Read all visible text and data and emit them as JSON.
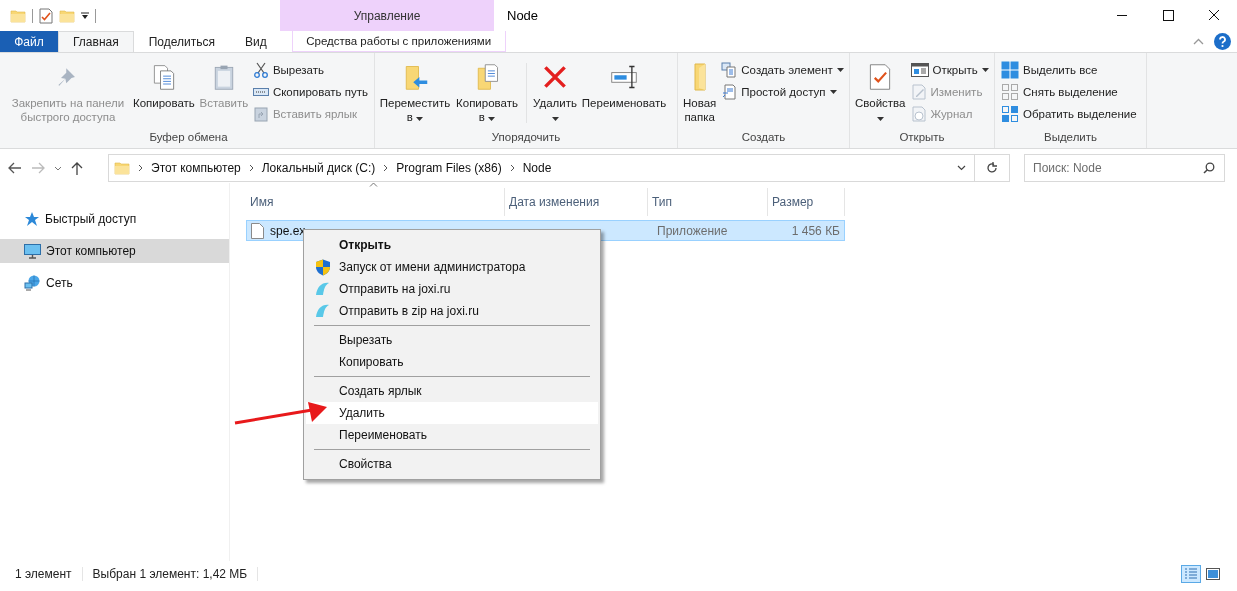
{
  "window": {
    "title": "Node",
    "context_header": "Управление"
  },
  "tabs": [
    {
      "label": "Файл",
      "kind": "file",
      "selected": false
    },
    {
      "label": "Главная",
      "kind": "normal",
      "selected": true
    },
    {
      "label": "Поделиться",
      "kind": "normal",
      "selected": false
    },
    {
      "label": "Вид",
      "kind": "normal",
      "selected": false
    },
    {
      "label": "Средства работы с приложениями",
      "kind": "contextual",
      "selected": false
    }
  ],
  "ribbon": {
    "groups": [
      {
        "label": "Буфер обмена",
        "items": [
          {
            "label": "Закрепить на панели быстрого доступа",
            "kind": "large",
            "disabled": true,
            "dropdown": false
          },
          {
            "label": "Копировать",
            "kind": "large",
            "disabled": false,
            "dropdown": false
          },
          {
            "label": "Вставить",
            "kind": "large",
            "disabled": true,
            "dropdown": false
          },
          {
            "label": "Вырезать",
            "kind": "small",
            "disabled": false,
            "dropdown": false
          },
          {
            "label": "Скопировать путь",
            "kind": "small",
            "disabled": false,
            "dropdown": false
          },
          {
            "label": "Вставить ярлык",
            "kind": "small",
            "disabled": true,
            "dropdown": false
          }
        ]
      },
      {
        "label": "Упорядочить",
        "items": [
          {
            "label": "Переместить в",
            "kind": "large",
            "disabled": false,
            "dropdown": true
          },
          {
            "label": "Копировать в",
            "kind": "large",
            "disabled": false,
            "dropdown": true
          },
          {
            "label": "Удалить",
            "kind": "large",
            "disabled": false,
            "dropdown": true
          },
          {
            "label": "Переименовать",
            "kind": "large",
            "disabled": false,
            "dropdown": false
          }
        ]
      },
      {
        "label": "Создать",
        "items": [
          {
            "label": "Новая папка",
            "kind": "large",
            "disabled": false,
            "dropdown": false
          },
          {
            "label": "Создать элемент",
            "kind": "small",
            "disabled": false,
            "dropdown": true
          },
          {
            "label": "Простой доступ",
            "kind": "small",
            "disabled": false,
            "dropdown": true
          }
        ]
      },
      {
        "label": "Открыть",
        "items": [
          {
            "label": "Свойства",
            "kind": "large",
            "disabled": false,
            "dropdown": true
          },
          {
            "label": "Открыть",
            "kind": "small",
            "disabled": false,
            "dropdown": true
          },
          {
            "label": "Изменить",
            "kind": "small",
            "disabled": true,
            "dropdown": false
          },
          {
            "label": "Журнал",
            "kind": "small",
            "disabled": true,
            "dropdown": false
          }
        ]
      },
      {
        "label": "Выделить",
        "items": [
          {
            "label": "Выделить все",
            "kind": "small",
            "disabled": false,
            "dropdown": false
          },
          {
            "label": "Снять выделение",
            "kind": "small",
            "disabled": false,
            "dropdown": false
          },
          {
            "label": "Обратить выделение",
            "kind": "small",
            "disabled": false,
            "dropdown": false
          }
        ]
      }
    ]
  },
  "address": {
    "breadcrumb": [
      "Этот компьютер",
      "Локальный диск (C:)",
      "Program Files (x86)",
      "Node"
    ],
    "search": {
      "placeholder": "Поиск: Node"
    }
  },
  "sidebar": {
    "items": [
      {
        "label": "Быстрый доступ",
        "selected": false
      },
      {
        "label": "Этот компьютер",
        "selected": true
      },
      {
        "label": "Сеть",
        "selected": false
      }
    ]
  },
  "table": {
    "columns": [
      "Имя",
      "Дата изменения",
      "Тип",
      "Размер"
    ],
    "rows": [
      {
        "name": "spe.ex",
        "type": "Приложение",
        "size": "1 456 КБ",
        "selected": true
      }
    ]
  },
  "context_menu": {
    "items": [
      {
        "kind": "item",
        "label": "Открыть",
        "default": true,
        "selected": false
      },
      {
        "kind": "item",
        "label": "Запуск от имени администратора",
        "default": false,
        "selected": false
      },
      {
        "kind": "item",
        "label": "Отправить на joxi.ru",
        "default": false,
        "selected": false
      },
      {
        "kind": "item",
        "label": "Отправить в zip на joxi.ru",
        "default": false,
        "selected": false
      },
      {
        "kind": "separator"
      },
      {
        "kind": "item",
        "label": "Вырезать",
        "default": false,
        "selected": false
      },
      {
        "kind": "item",
        "label": "Копировать",
        "default": false,
        "selected": false
      },
      {
        "kind": "separator"
      },
      {
        "kind": "item",
        "label": "Создать ярлык",
        "default": false,
        "selected": false
      },
      {
        "kind": "item",
        "label": "Удалить",
        "default": false,
        "selected": true
      },
      {
        "kind": "item",
        "label": "Переименовать",
        "default": false,
        "selected": false
      },
      {
        "kind": "separator"
      },
      {
        "kind": "item",
        "label": "Свойства",
        "default": false,
        "selected": false
      }
    ]
  },
  "status_bar": {
    "items": [
      "1 элемент",
      "Выбран 1 элемент: 1,42 МБ"
    ],
    "views": [
      {
        "selected": true
      },
      {
        "selected": false
      }
    ]
  }
}
